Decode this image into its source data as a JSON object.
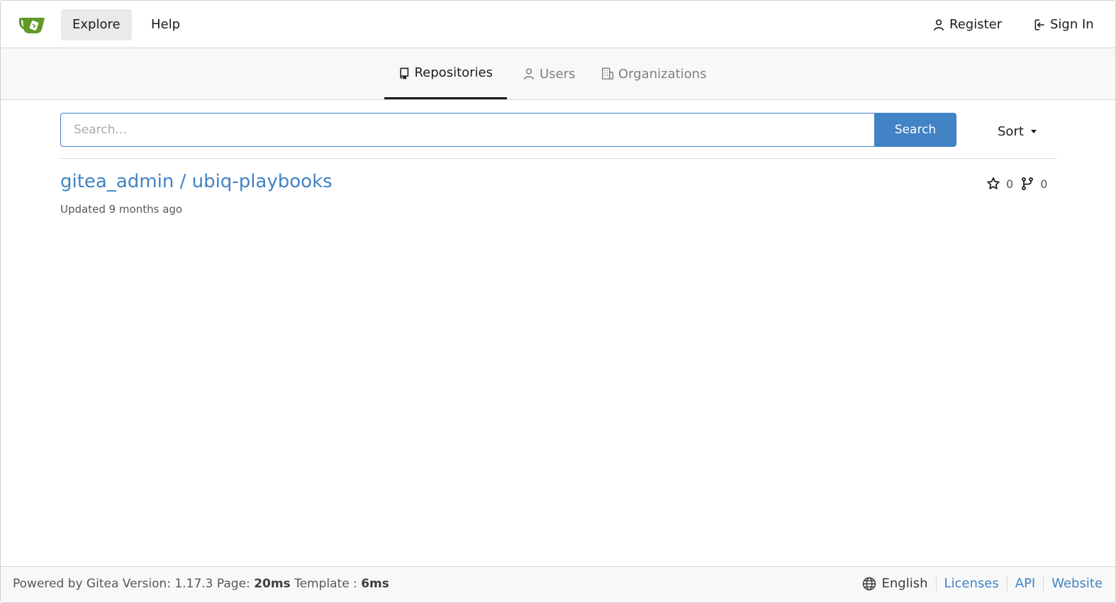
{
  "navbar": {
    "explore": "Explore",
    "help": "Help",
    "register": "Register",
    "sign_in": "Sign In"
  },
  "tabs": {
    "repositories": "Repositories",
    "users": "Users",
    "organizations": "Organizations"
  },
  "search": {
    "placeholder": "Search...",
    "button": "Search",
    "sort": "Sort"
  },
  "repo": {
    "title": "gitea_admin / ubiq-playbooks",
    "updated": "Updated 9 months ago",
    "stars": "0",
    "forks": "0"
  },
  "footer": {
    "powered": "Powered by Gitea Version: 1.17.3 Page: ",
    "page_time": "20ms",
    "template_label": " Template : ",
    "template_time": "6ms",
    "language": "English",
    "licenses": "Licenses",
    "api": "API",
    "website": "Website"
  },
  "colors": {
    "accent": "#4183c4",
    "logo": "#609926"
  }
}
